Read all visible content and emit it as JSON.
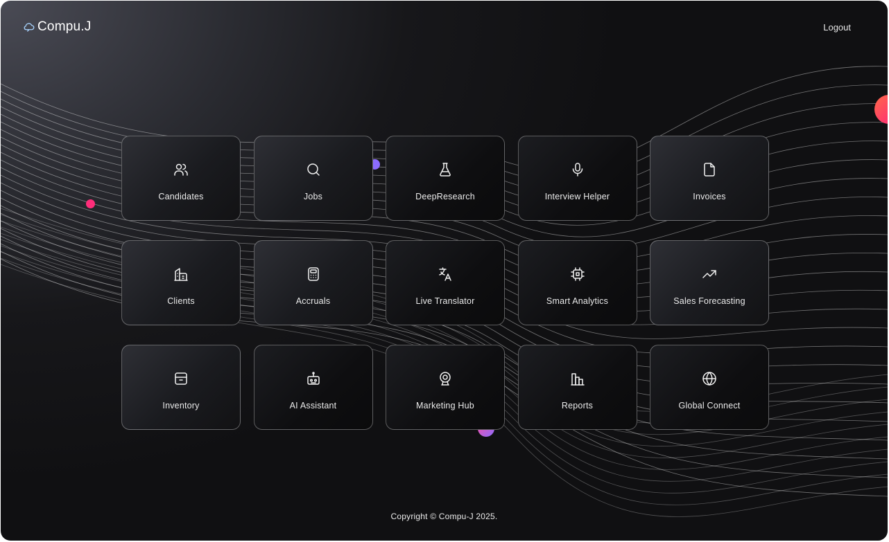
{
  "header": {
    "logo": "Compu.J",
    "logout": "Logout"
  },
  "tiles": [
    {
      "label": "Candidates",
      "icon": "users-icon"
    },
    {
      "label": "Jobs",
      "icon": "search-icon"
    },
    {
      "label": "DeepResearch",
      "icon": "flask-icon"
    },
    {
      "label": "Interview Helper",
      "icon": "microphone-icon"
    },
    {
      "label": "Invoices",
      "icon": "file-icon"
    },
    {
      "label": "Clients",
      "icon": "building-icon"
    },
    {
      "label": "Accruals",
      "icon": "calculator-icon"
    },
    {
      "label": "Live Translator",
      "icon": "translate-icon"
    },
    {
      "label": "Smart Analytics",
      "icon": "cpu-icon"
    },
    {
      "label": "Sales Forecasting",
      "icon": "trending-up-icon"
    },
    {
      "label": "Inventory",
      "icon": "box-icon"
    },
    {
      "label": "AI Assistant",
      "icon": "robot-icon"
    },
    {
      "label": "Marketing Hub",
      "icon": "webcam-icon"
    },
    {
      "label": "Reports",
      "icon": "bar-chart-icon"
    },
    {
      "label": "Global Connect",
      "icon": "globe-icon"
    }
  ],
  "footer": {
    "copyright": "Copyright © Compu-J 2025."
  },
  "colors": {
    "accent_pink": "#ff2d7a",
    "accent_purple": "#8b6cff",
    "background": "#141416"
  }
}
